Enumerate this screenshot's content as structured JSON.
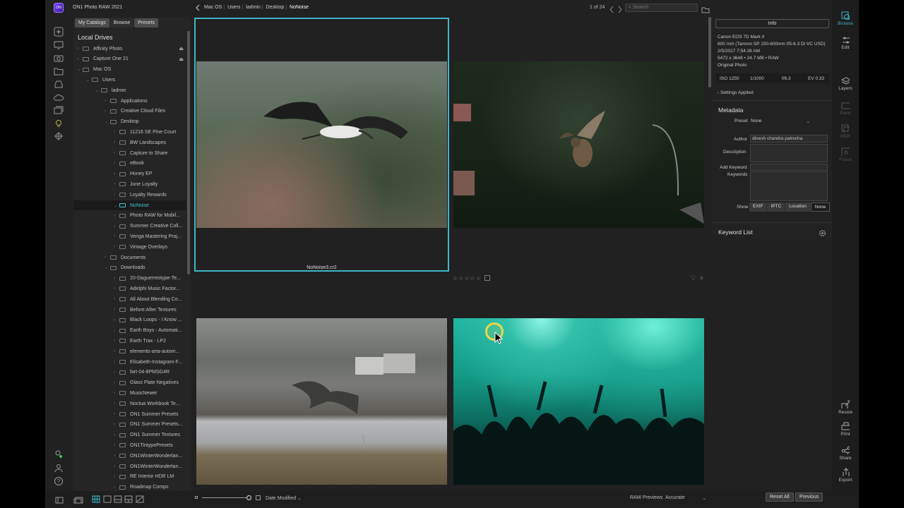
{
  "app": {
    "title": "ON1 Photo RAW 2021",
    "logo_text": "ON"
  },
  "breadcrumb": [
    "Mac OS",
    "Users",
    "ladmin",
    "Desktop",
    "NoNoise"
  ],
  "pager": {
    "text": "1 of 24"
  },
  "search": {
    "placeholder": "Search"
  },
  "browser_tabs": [
    {
      "label": "My Catalogs"
    },
    {
      "label": "Browse"
    },
    {
      "label": "Presets"
    }
  ],
  "local_drives_label": "Local Drives",
  "tree": [
    {
      "label": "Affinity Photo"
    },
    {
      "label": "Capture One 21"
    },
    {
      "label": "Mac OS"
    },
    {
      "label": "Users"
    },
    {
      "label": "ladmin"
    },
    {
      "label": "Applications"
    },
    {
      "label": "Creative Cloud Files"
    },
    {
      "label": "Desktop"
    },
    {
      "label": "11216 SE Pine Court"
    },
    {
      "label": "BW Landscapes"
    },
    {
      "label": "Capture to Share"
    },
    {
      "label": "eBook"
    },
    {
      "label": "Honey EP"
    },
    {
      "label": "June Loyalty"
    },
    {
      "label": "Loyalty Rewards"
    },
    {
      "label": "NoNoise"
    },
    {
      "label": "Photo RAW for Mobil..."
    },
    {
      "label": "Summer Creative Coll..."
    },
    {
      "label": "Venga Mastering Proj..."
    },
    {
      "label": "Vintage Overlays"
    },
    {
      "label": "Documents"
    },
    {
      "label": "Downloads"
    },
    {
      "label": "20-Daguerreotype-Te..."
    },
    {
      "label": "Adelphi Music Factor..."
    },
    {
      "label": "All About Blending Co..."
    },
    {
      "label": "Before:After Textures"
    },
    {
      "label": "Black Loops - I Know ..."
    },
    {
      "label": "Earth Boys - Automati..."
    },
    {
      "label": "Earth Trax - LP2"
    },
    {
      "label": "elements-arta-autom..."
    },
    {
      "label": "Elisabeth-Instagram-F..."
    },
    {
      "label": "fart-04-8PMSG4R"
    },
    {
      "label": "Glass Plate Negatives"
    },
    {
      "label": "MusicNewer"
    },
    {
      "label": "Noctua Workbook Te..."
    },
    {
      "label": "ON1 Summer Presets"
    },
    {
      "label": "ON1 Summer Presets..."
    },
    {
      "label": "ON1 Summer Textures"
    },
    {
      "label": "ON1TintypePresets"
    },
    {
      "label": "ON1WinterWonderlan..."
    },
    {
      "label": "ON1WinterWonderlan..."
    },
    {
      "label": "RE Interior HDR LM"
    },
    {
      "label": "Roadmap Comps"
    }
  ],
  "grid": {
    "selected_filename": "NoNoise3.cr2",
    "rating_stars": "☆☆☆☆☆"
  },
  "info": {
    "button": "Info",
    "camera": "Canon EOS 7D Mark II",
    "lens": "600 mm (Tamron SP 150-600mm f/5-6.3 Di VC USD)",
    "datetime": "2/5/2017 7:54:26 AM",
    "size": "5472 x 3648 • 24.7 MB • RAW",
    "status": "Original Photo",
    "iso": "ISO 1250",
    "shutter": "1/1000",
    "aperture": "f/6.3",
    "ev": "EV 0.33",
    "settings_applied": "Settings Applied"
  },
  "metadata": {
    "title": "Metadata",
    "preset_label": "Preset",
    "preset_value": "None",
    "author_label": "Author",
    "author_value": "dinesh chandra palrecha",
    "description_label": "Description",
    "add_keyword_label": "Add Keyword",
    "keywords_label": "Keywords",
    "show_label": "Show",
    "show_options": [
      {
        "label": "EXIF"
      },
      {
        "label": "IPTC"
      },
      {
        "label": "Location"
      },
      {
        "label": "None"
      }
    ]
  },
  "keyword_list_label": "Keyword List",
  "modules": {
    "browse": "Browse",
    "edit": "Edit",
    "layers": "Layers",
    "pano": "Pano",
    "hdr": "HDR",
    "focus": "Focus",
    "resize": "Resize",
    "print": "Print",
    "share": "Share",
    "export": "Export"
  },
  "bottom": {
    "sort": "Date Modified",
    "raw_previews_label": "RAW Previews",
    "raw_previews_value": "Accurate",
    "reset_all": "Reset All",
    "previous": "Previous"
  },
  "colors": {
    "accent": "#3fb6c8",
    "panel": "#252525",
    "background": "#212121"
  }
}
